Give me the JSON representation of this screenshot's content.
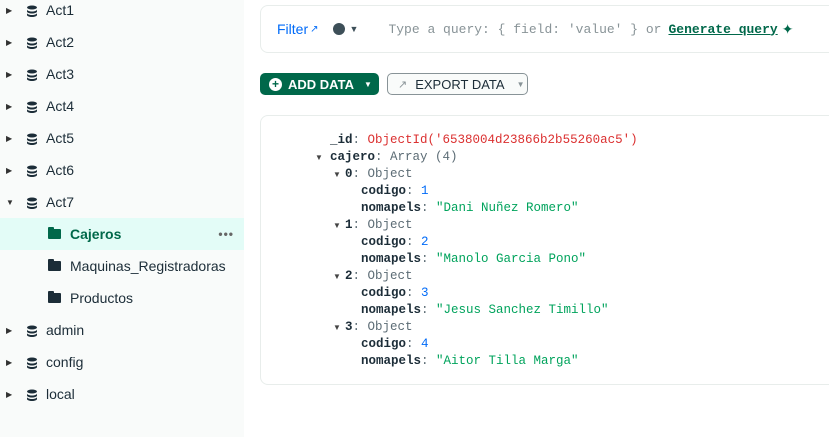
{
  "sidebar": {
    "databases": [
      {
        "label": "Act1"
      },
      {
        "label": "Act2"
      },
      {
        "label": "Act3"
      },
      {
        "label": "Act4"
      },
      {
        "label": "Act5"
      },
      {
        "label": "Act6"
      },
      {
        "label": "Act7",
        "expanded": true
      },
      {
        "label": "admin"
      },
      {
        "label": "config"
      },
      {
        "label": "local"
      }
    ],
    "collections": [
      {
        "label": "Cajeros",
        "selected": true
      },
      {
        "label": "Maquinas_Registradoras"
      },
      {
        "label": "Productos"
      }
    ],
    "more_icon": "ellipsis-icon"
  },
  "filter": {
    "label": "Filter",
    "placeholder": "Type a query: { field: 'value' } or",
    "generate": "Generate query"
  },
  "toolbar": {
    "add": "ADD DATA",
    "export": "EXPORT DATA"
  },
  "document": {
    "id_key": "_id",
    "id_value": "ObjectId('6538004d23866b2b55260ac5')",
    "array_key": "cajero",
    "array_type": "Array (4)",
    "items": [
      {
        "index": "0",
        "type": "Object",
        "codigo": "1",
        "nomapels": "\"Dani Nuñez Romero\""
      },
      {
        "index": "1",
        "type": "Object",
        "codigo": "2",
        "nomapels": "\"Manolo Garcia Pono\""
      },
      {
        "index": "2",
        "type": "Object",
        "codigo": "3",
        "nomapels": "\"Jesus Sanchez Timillo\""
      },
      {
        "index": "3",
        "type": "Object",
        "codigo": "4",
        "nomapels": "\"Aitor Tilla Marga\""
      }
    ]
  },
  "colors": {
    "accent": "#00684a",
    "selected_bg": "#e3fcf7",
    "objectid": "#db3030",
    "number": "#016bf8",
    "string": "#00a35c"
  }
}
